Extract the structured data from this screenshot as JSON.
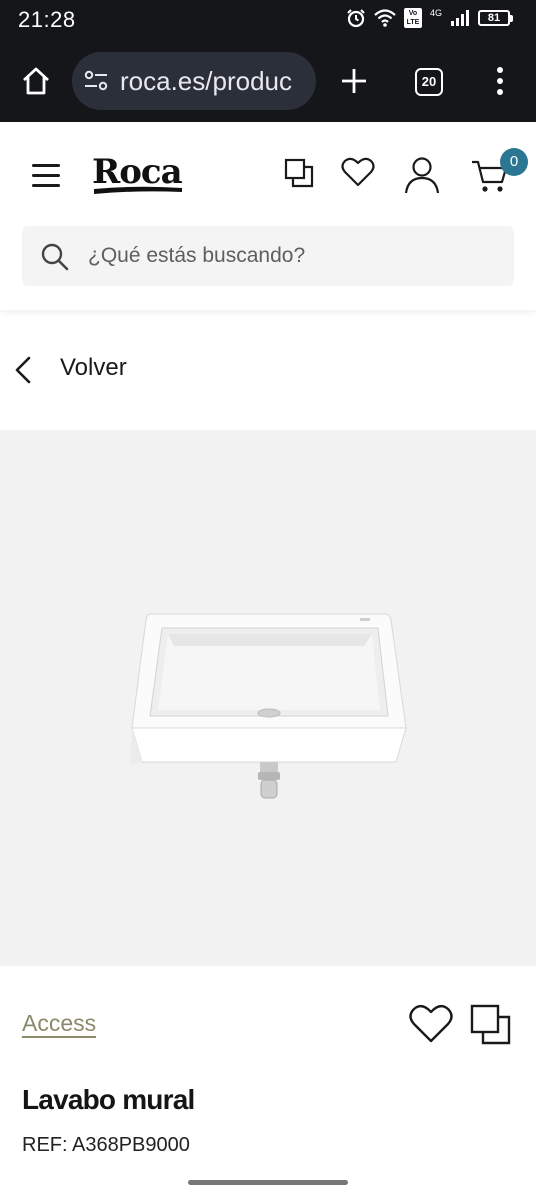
{
  "status_bar": {
    "time": "21:28",
    "battery": "81",
    "network": "4G",
    "volte": "Vo LTE"
  },
  "browser": {
    "url": "roca.es/produc",
    "tab_count": "20"
  },
  "header": {
    "logo": "Roca",
    "cart_count": "0",
    "search_placeholder": "¿Qué estás buscando?"
  },
  "nav": {
    "back_label": "Volver"
  },
  "product": {
    "brand": "Access",
    "name": "Lavabo mural",
    "ref": "REF: A368PB9000"
  },
  "colors": {
    "accent": "#2a7693",
    "brand_link": "#8a8a6a",
    "browser_bg": "#14161a"
  }
}
